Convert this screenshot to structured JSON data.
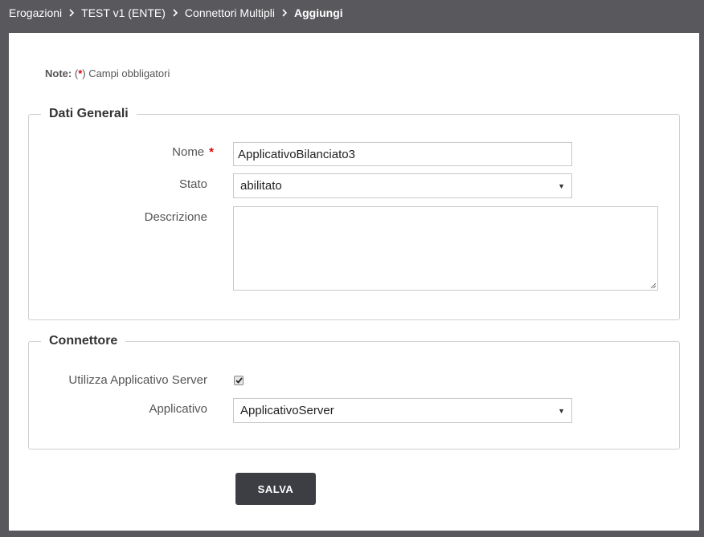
{
  "breadcrumb": {
    "items": [
      "Erogazioni",
      "TEST v1 (ENTE)",
      "Connettori Multipli"
    ],
    "current": "Aggiungi"
  },
  "note": {
    "title": "Note:",
    "open": "(",
    "star": "*",
    "text": ") Campi obbligatori"
  },
  "dati_generali": {
    "legend": "Dati Generali",
    "nome": {
      "label": "Nome",
      "required": "*",
      "value": "ApplicativoBilanciato3"
    },
    "stato": {
      "label": "Stato",
      "value": "abilitato"
    },
    "descrizione": {
      "label": "Descrizione",
      "value": ""
    }
  },
  "connettore": {
    "legend": "Connettore",
    "utilizza": {
      "label": "Utilizza Applicativo Server",
      "checked": true
    },
    "applicativo": {
      "label": "Applicativo",
      "value": "ApplicativoServer"
    }
  },
  "actions": {
    "save_label": "SALVA"
  },
  "colors": {
    "background": "#58585d",
    "panel": "#ffffff",
    "button": "#3c3e44",
    "required": "#dd0000"
  },
  "icons": {
    "separator": "chevron-right-icon",
    "select": "caret-down-icon",
    "checkbox": "check-icon"
  }
}
